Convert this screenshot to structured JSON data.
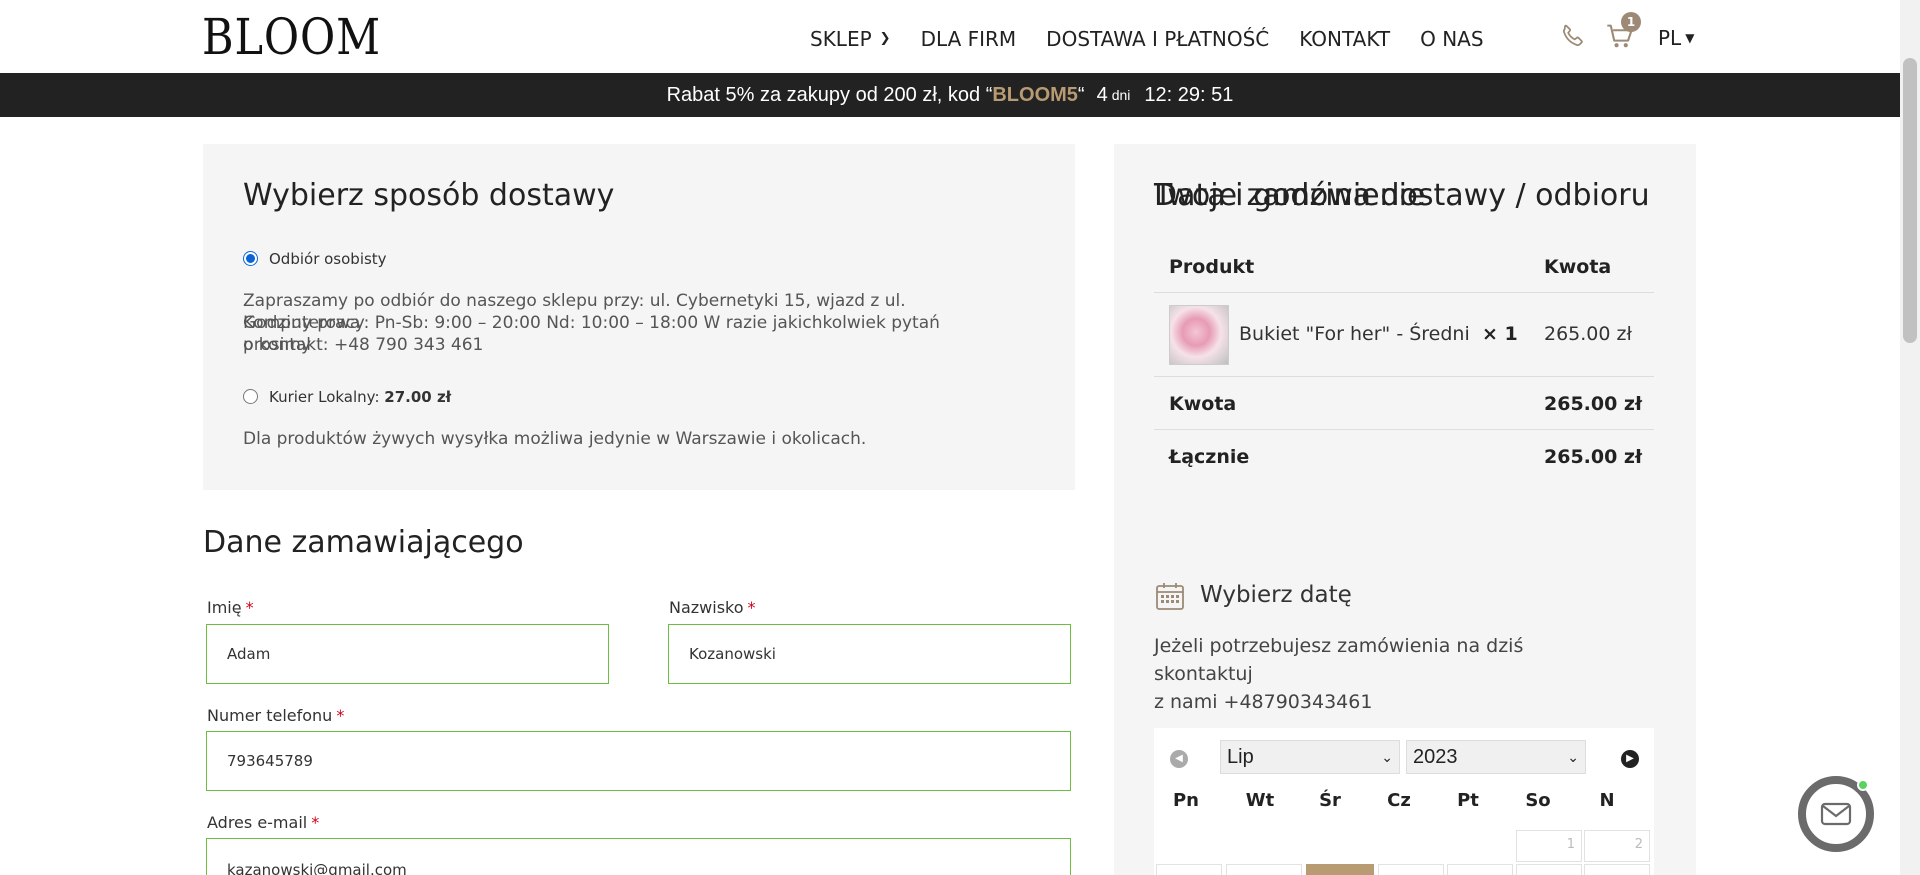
{
  "header": {
    "logo": "BLOOM",
    "nav": [
      "SKLEP",
      "DLA FIRM",
      "DOSTAWA I PŁATNOŚĆ",
      "KONTAKT",
      "O NAS"
    ],
    "cart_count": "1",
    "language": "PL"
  },
  "promo": {
    "text_before": "Rabat 5% za zakupy od 200 zł, kod “",
    "code": "BLOOM5",
    "text_after": "“",
    "days": "4",
    "days_label": "dni",
    "countdown": "12: 29: 51"
  },
  "delivery": {
    "title": "Wybierz sposób dostawy",
    "option1_label": "Odbiór osobisty",
    "option1_desc_l1": "Zapraszamy po odbiór do naszego sklepu przy: ul. Cybernetyki 15, wjazd z ul. Komputerowa",
    "option1_desc_l2": "Godziny pracy: Pn-Sb: 9:00 – 20:00 Nd: 10:00 – 18:00 W razie jakichkolwiek pytań prosimy",
    "option1_desc_l3": "o kontakt: +48 790 343 461",
    "option2_label": "Kurier Lokalny:",
    "option2_price": "27.00 zł",
    "option2_desc": "Dla produktów żywych wysyłka możliwa jedynie w Warszawie i okolicach."
  },
  "customer": {
    "title": "Dane zamawiającego",
    "first_name_label": "Imię",
    "first_name_value": "Adam",
    "last_name_label": "Nazwisko",
    "last_name_value": "Kozanowski",
    "phone_label": "Numer telefonu",
    "phone_value": "793645789",
    "email_label": "Adres e-mail",
    "email_value": "kazanowski@gmail.com",
    "required_mark": "*"
  },
  "order": {
    "title": "Twoje zamówienie",
    "col_product": "Produkt",
    "col_amount": "Kwota",
    "item_name": "Bukiet \"For her\" - Średni",
    "item_qty": "× 1",
    "item_price": "265.00 zł",
    "subtotal_label": "Kwota",
    "subtotal_value": "265.00 zł",
    "total_label": "Łącznie",
    "total_value": "265.00 zł"
  },
  "datetime": {
    "title": "Data i godzina dostawy / odbioru",
    "choose_date": "Wybierz datę",
    "note_l1": "Jeżeli potrzebujesz zamówienia na dziś skontaktuj",
    "note_l2": "z nami +48790343461",
    "month": "Lip",
    "year": "2023",
    "weekdays": [
      "Pn",
      "Wt",
      "Śr",
      "Cz",
      "Pt",
      "So",
      "N"
    ],
    "day1": "1",
    "day2": "2"
  }
}
